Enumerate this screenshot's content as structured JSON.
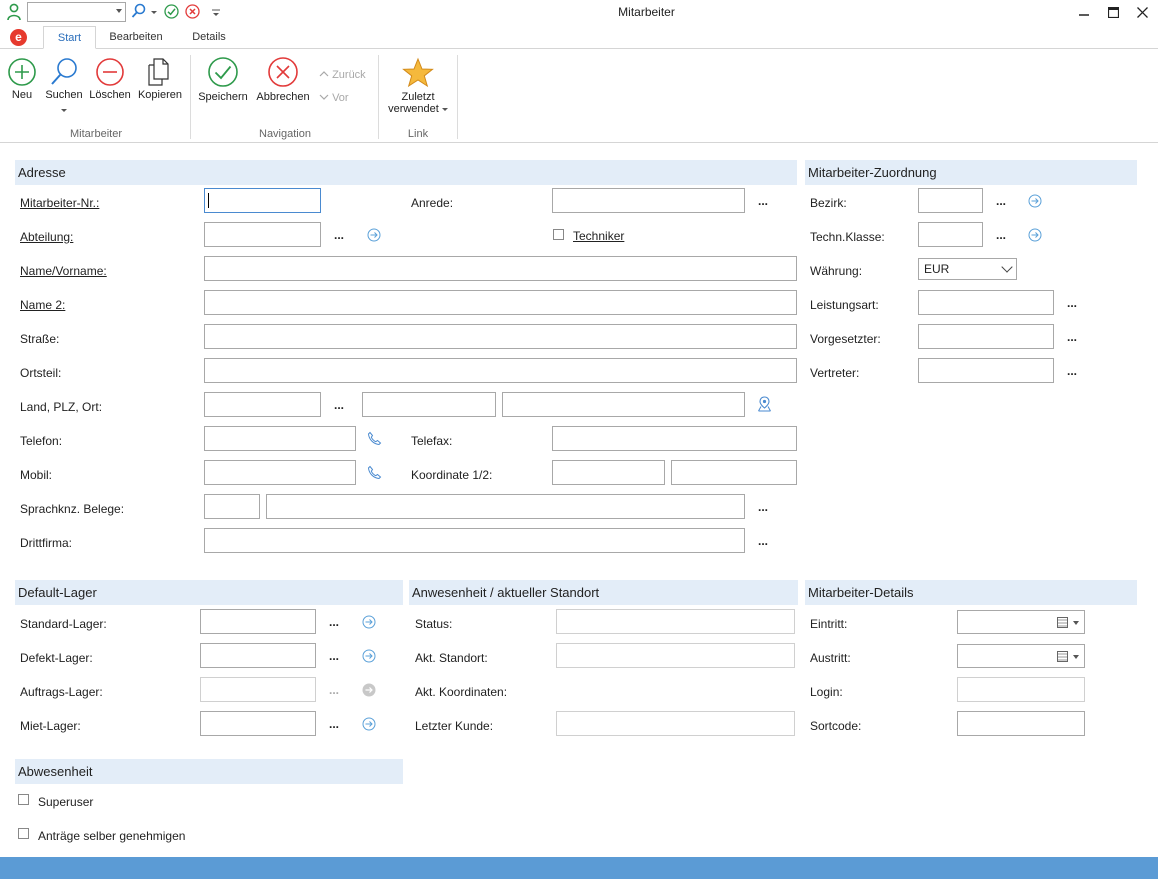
{
  "window": {
    "title": "Mitarbeiter"
  },
  "ribbon_tabs": [
    "Start",
    "Bearbeiten",
    "Details"
  ],
  "ribbon": {
    "groups": [
      "Mitarbeiter",
      "Navigation",
      "Link"
    ],
    "buttons": {
      "neu": "Neu",
      "suchen": "Suchen",
      "loeschen": "Löschen",
      "kopieren": "Kopieren",
      "speichern": "Speichern",
      "abbrechen": "Abbrechen",
      "zurueck": "Zurück",
      "vor": "Vor",
      "zuletzt_1": "Zuletzt",
      "zuletzt_2": "verwendet"
    }
  },
  "sections": {
    "adresse": "Adresse",
    "zuordnung": "Mitarbeiter-Zuordnung",
    "default_lager": "Default-Lager",
    "anwesenheit": "Anwesenheit / aktueller Standort",
    "details": "Mitarbeiter-Details",
    "abwesenheit": "Abwesenheit"
  },
  "adresse": {
    "mitarbeiter_nr": "Mitarbeiter-Nr.:",
    "anrede": "Anrede:",
    "abteilung": "Abteilung:",
    "techniker": "Techniker",
    "name_vorname": "Name/Vorname:",
    "name2": "Name 2:",
    "strasse": "Straße:",
    "ortsteil": "Ortsteil:",
    "land_plz_ort": "Land, PLZ, Ort:",
    "telefon": "Telefon:",
    "telefax": "Telefax:",
    "mobil": "Mobil:",
    "koordinate": "Koordinate 1/2:",
    "sprachknz": "Sprachknz. Belege:",
    "drittfirma": "Drittfirma:"
  },
  "zuordnung": {
    "bezirk": "Bezirk:",
    "techn_klasse": "Techn.Klasse:",
    "waehrung": "Währung:",
    "waehrung_value": "EUR",
    "leistungsart": "Leistungsart:",
    "vorgesetzter": "Vorgesetzter:",
    "vertreter": "Vertreter:"
  },
  "default_lager": {
    "standard": "Standard-Lager:",
    "defekt": "Defekt-Lager:",
    "auftrags": "Auftrags-Lager:",
    "miet": "Miet-Lager:"
  },
  "anwesenheit": {
    "status": "Status:",
    "akt_standort": "Akt. Standort:",
    "akt_koordinaten": "Akt. Koordinaten:",
    "letzter_kunde": "Letzter Kunde:"
  },
  "details": {
    "eintritt": "Eintritt:",
    "austritt": "Austritt:",
    "login": "Login:",
    "sortcode": "Sortcode:"
  },
  "abwesenheit": {
    "superuser": "Superuser",
    "antraege": "Anträge selber genehmigen"
  },
  "ellipsis": "..."
}
